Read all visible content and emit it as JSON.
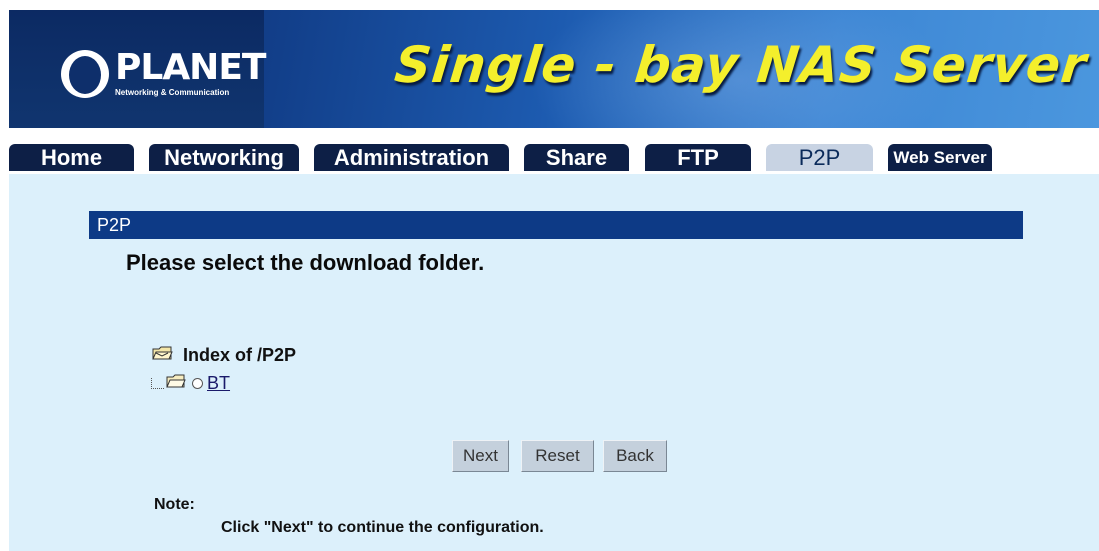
{
  "banner": {
    "logo_name": "PLANET",
    "logo_subtitle": "Networking & Communication",
    "title": "Single - bay NAS Server"
  },
  "nav": {
    "tabs": [
      {
        "label": "Home",
        "active": false
      },
      {
        "label": "Networking",
        "active": false
      },
      {
        "label": "Administration",
        "active": false
      },
      {
        "label": "Share",
        "active": false
      },
      {
        "label": "FTP",
        "active": false
      },
      {
        "label": "P2P",
        "active": true
      },
      {
        "label": "Web Server",
        "active": false
      }
    ]
  },
  "main": {
    "section_title": "P2P",
    "heading": "Please select the download folder.",
    "tree": {
      "root_label": "Index of /P2P",
      "children": [
        {
          "label": "BT",
          "selected": false
        }
      ]
    },
    "buttons": {
      "next": "Next",
      "reset": "Reset",
      "back": "Back"
    },
    "note_label": "Note:",
    "note_text": "Click \"Next\" to continue the configuration."
  },
  "icons": {
    "folder_open": "open-folder-icon",
    "folder": "folder-icon"
  },
  "colors": {
    "section_bar": "#0d3a86",
    "content_bg": "#dcf0fb",
    "tab_bg": "#0d1f46",
    "tab_active_bg": "#c8d3e3",
    "title_yellow": "#f4ef2c"
  }
}
